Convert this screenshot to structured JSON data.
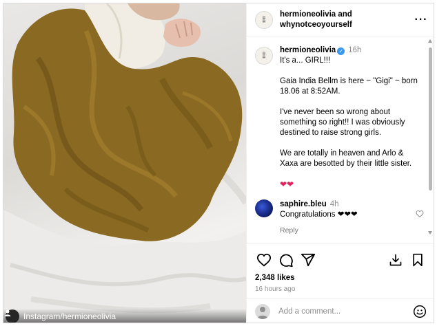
{
  "photo": {
    "credit": "Instagram/hermioneolivia"
  },
  "header": {
    "account_1": "hermioneolivia",
    "and": "and",
    "account_2": "whynotceoyourself",
    "more_icon": "more-horizontal-icon"
  },
  "caption": {
    "username": "hermioneolivia",
    "time": "16h",
    "lines": [
      "It's a... GIRL!!!",
      "Gaia India Bellm is here ~ \"Gigi\" ~ born 18.06 at 8:52AM.",
      "I've never been so wrong about something so right!! I was obviously destined to raise strong girls.",
      "We are totally in heaven and Arlo & Xaxa are besotted by their little sister.",
      "❤❤"
    ]
  },
  "comment": {
    "username": "saphire.bleu",
    "time": "4h",
    "text": "Congratulations ❤❤❤",
    "reply": "Reply"
  },
  "actions": {
    "likes": "2,348 likes",
    "ago": "16 hours ago"
  },
  "add_comment": {
    "placeholder": "Add a comment..."
  },
  "colors": {
    "verified": "#3897f0",
    "heart": "#e0245e",
    "blanket": "#8a6a22"
  }
}
